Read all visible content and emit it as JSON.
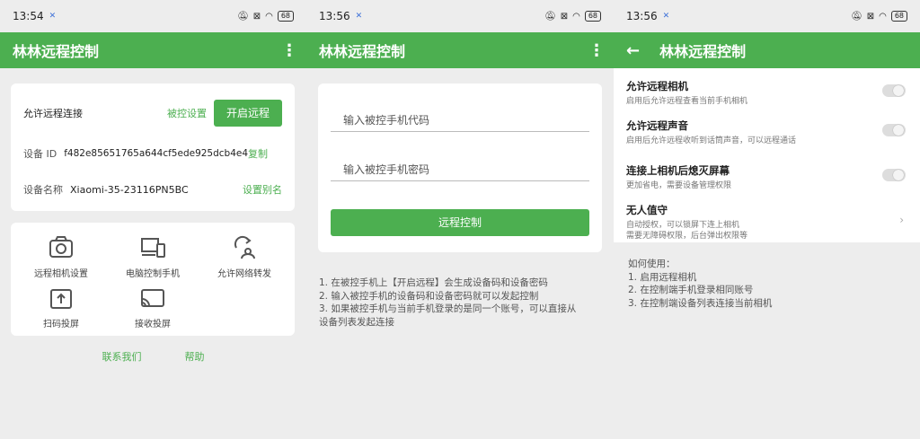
{
  "p1": {
    "status": {
      "time": "13:54",
      "bt": "✕",
      "battery": "68"
    },
    "appbar": {
      "title": "林林远程控制",
      "menu": "⋮"
    },
    "allow_remote": {
      "label": "允许远程连接",
      "link": "被控设置",
      "button": "开启远程"
    },
    "device_id": {
      "label": "设备 ID",
      "value": "f482e85651765a644cf5ede925dcb4e4",
      "action": "复制"
    },
    "device_name": {
      "label": "设备名称",
      "value": "Xiaomi-35-23116PN5BC",
      "action": "设置别名"
    },
    "grid": [
      {
        "label": "远程相机设置",
        "icon": "camera-icon"
      },
      {
        "label": "电脑控制手机",
        "icon": "devices-icon"
      },
      {
        "label": "允许网络转发",
        "icon": "network-forward-icon"
      },
      {
        "label": "扫码投屏",
        "icon": "upload-screen-icon"
      },
      {
        "label": "接收投屏",
        "icon": "cast-icon"
      }
    ],
    "links": {
      "contact": "联系我们",
      "help": "帮助"
    }
  },
  "p2": {
    "status": {
      "time": "13:56",
      "bt": "✕",
      "battery": "68"
    },
    "appbar": {
      "title": "林林远程控制",
      "menu": "⋮"
    },
    "code_placeholder": "输入被控手机代码",
    "password_placeholder": "输入被控手机密码",
    "connect_button": "远程控制",
    "notes": [
      "1. 在被控手机上【开启远程】会生成设备码和设备密码",
      "2. 输入被控手机的设备码和设备密码就可以发起控制",
      "3. 如果被控手机与当前手机登录的是同一个账号，可以直接从",
      "设备列表发起连接"
    ]
  },
  "p3": {
    "status": {
      "time": "13:56",
      "bt": "✕",
      "battery": "68"
    },
    "appbar": {
      "title": "林林远程控制",
      "back": "←"
    },
    "settings": [
      {
        "title": "允许远程相机",
        "desc": "启用后允许远程查看当前手机相机"
      },
      {
        "title": "允许远程声音",
        "desc": "启用后允许远程收听到话筒声音，可以远程通话"
      },
      {
        "title": "连接上相机后熄灭屏幕",
        "desc": "更加省电，需要设备管理权限"
      },
      {
        "title": "无人值守",
        "desc": "自动授权，可以锁屏下连上相机",
        "desc2": "需要无障碍权限，后台弹出权限等"
      }
    ],
    "howto": [
      "如何使用：",
      "1. 启用远程相机",
      "2. 在控制端手机登录相同账号",
      "3. 在控制端设备列表连接当前相机"
    ]
  },
  "colors": {
    "accent": "#4caf50",
    "background": "#ededed"
  }
}
